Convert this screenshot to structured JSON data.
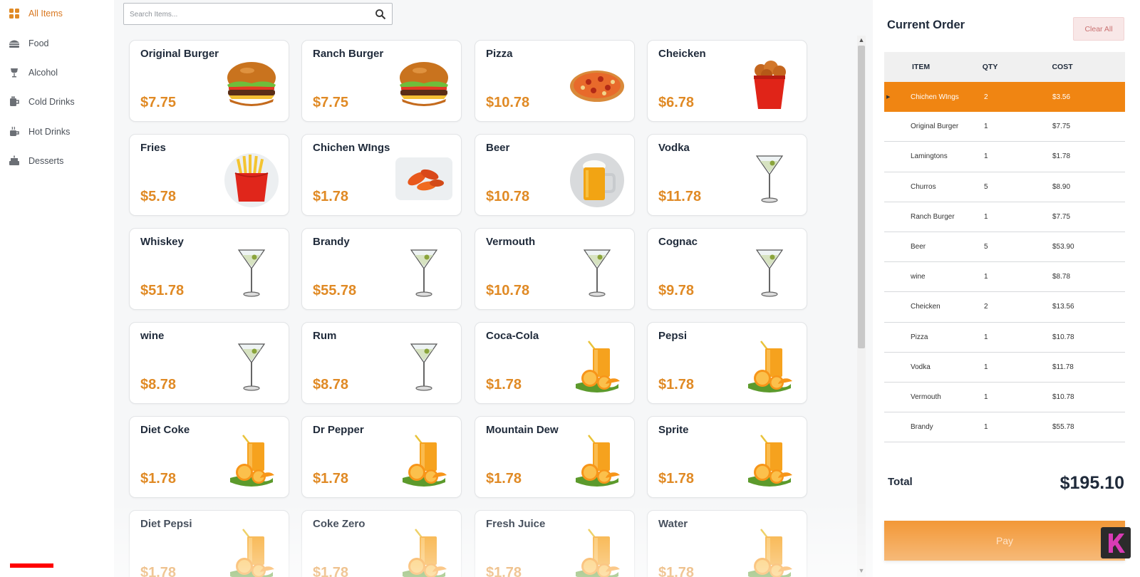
{
  "sidebar": {
    "categories": [
      {
        "label": "All Items",
        "icon": "grid-icon",
        "active": true
      },
      {
        "label": "Food",
        "icon": "burger-icon",
        "active": false
      },
      {
        "label": "Alcohol",
        "icon": "wine-glass-icon",
        "active": false
      },
      {
        "label": "Cold Drinks",
        "icon": "cup-icon",
        "active": false
      },
      {
        "label": "Hot Drinks",
        "icon": "coffee-icon",
        "active": false
      },
      {
        "label": "Desserts",
        "icon": "cake-icon",
        "active": false
      }
    ]
  },
  "search": {
    "placeholder": "Search Items..."
  },
  "products": [
    {
      "name": "Original Burger",
      "price": "$7.75",
      "image": "burger"
    },
    {
      "name": "Ranch Burger",
      "price": "$7.75",
      "image": "burger"
    },
    {
      "name": "Pizza",
      "price": "$10.78",
      "image": "pizza"
    },
    {
      "name": "Cheicken",
      "price": "$6.78",
      "image": "chicken-bucket"
    },
    {
      "name": "Fries",
      "price": "$5.78",
      "image": "fries"
    },
    {
      "name": "Chichen WIngs",
      "price": "$1.78",
      "image": "wings"
    },
    {
      "name": "Beer",
      "price": "$10.78",
      "image": "beer"
    },
    {
      "name": "Vodka",
      "price": "$11.78",
      "image": "martini"
    },
    {
      "name": "Whiskey",
      "price": "$51.78",
      "image": "martini"
    },
    {
      "name": "Brandy",
      "price": "$55.78",
      "image": "martini"
    },
    {
      "name": "Vermouth",
      "price": "$10.78",
      "image": "martini"
    },
    {
      "name": "Cognac",
      "price": "$9.78",
      "image": "martini"
    },
    {
      "name": "wine",
      "price": "$8.78",
      "image": "martini"
    },
    {
      "name": "Rum",
      "price": "$8.78",
      "image": "martini"
    },
    {
      "name": "Coca-Cola",
      "price": "$1.78",
      "image": "juice"
    },
    {
      "name": "Pepsi",
      "price": "$1.78",
      "image": "juice"
    },
    {
      "name": "Diet Coke",
      "price": "$1.78",
      "image": "juice"
    },
    {
      "name": "Dr Pepper",
      "price": "$1.78",
      "image": "juice"
    },
    {
      "name": "Mountain Dew",
      "price": "$1.78",
      "image": "juice"
    },
    {
      "name": "Sprite",
      "price": "$1.78",
      "image": "juice"
    },
    {
      "name": "Diet Pepsi",
      "price": "$1.78",
      "image": "juice"
    },
    {
      "name": "Coke Zero",
      "price": "$1.78",
      "image": "juice"
    },
    {
      "name": "Fresh Juice",
      "price": "$1.78",
      "image": "juice"
    },
    {
      "name": "Water",
      "price": "$1.78",
      "image": "juice"
    }
  ],
  "order": {
    "title": "Current Order",
    "clear_label": "Clear All",
    "columns": {
      "item": "ITEM",
      "qty": "QTY",
      "cost": "COST"
    },
    "rows": [
      {
        "item": "Chichen WIngs",
        "qty": "2",
        "cost": "$3.56",
        "selected": true
      },
      {
        "item": "Original Burger",
        "qty": "1",
        "cost": "$7.75"
      },
      {
        "item": "Lamingtons",
        "qty": "1",
        "cost": "$1.78"
      },
      {
        "item": "Churros",
        "qty": "5",
        "cost": "$8.90"
      },
      {
        "item": "Ranch Burger",
        "qty": "1",
        "cost": "$7.75"
      },
      {
        "item": "Beer",
        "qty": "5",
        "cost": "$53.90"
      },
      {
        "item": "wine",
        "qty": "1",
        "cost": "$8.78"
      },
      {
        "item": "Cheicken",
        "qty": "2",
        "cost": "$13.56"
      },
      {
        "item": "Pizza",
        "qty": "1",
        "cost": "$10.78"
      },
      {
        "item": "Vodka",
        "qty": "1",
        "cost": "$11.78"
      },
      {
        "item": "Vermouth",
        "qty": "1",
        "cost": "$10.78"
      },
      {
        "item": "Brandy",
        "qty": "1",
        "cost": "$55.78"
      }
    ],
    "total_label": "Total",
    "total_value": "$195.10",
    "pay_label": "Pay"
  },
  "colors": {
    "accent": "#f08512",
    "price": "#e08a25",
    "active_category": "#d9771f",
    "text": "#1f2a3a"
  },
  "video": {
    "progress_fraction": 0.47,
    "badge_letter": "k"
  }
}
